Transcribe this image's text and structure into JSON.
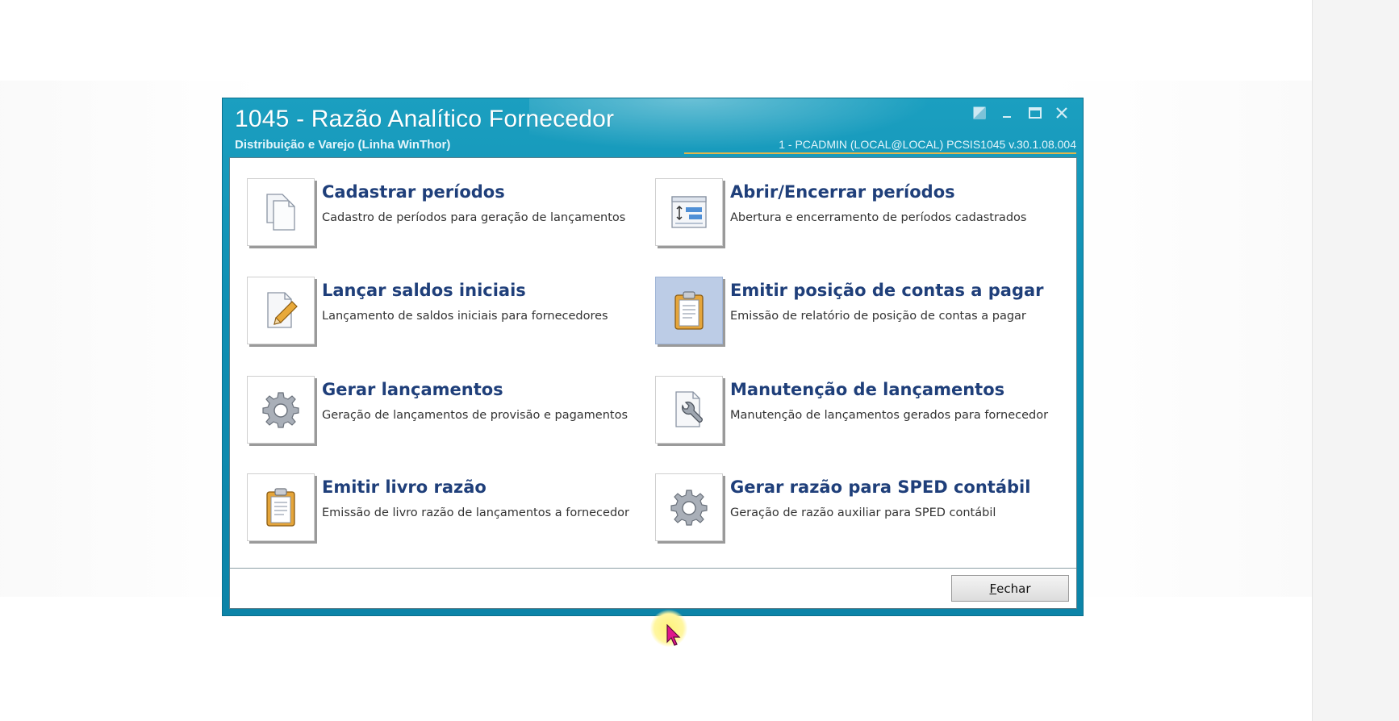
{
  "window": {
    "title": "1045 - Razão Analítico Fornecedor",
    "subtitle": "Distribuição e Varejo (Linha WinThor)",
    "user_info": "1 - PCADMIN (LOCAL@LOCAL)   PCSIS1045  v.30.1.08.004"
  },
  "tiles": [
    {
      "title": "Cadastrar períodos",
      "description": "Cadastro de períodos para geração de lançamentos",
      "icon": "documents-icon"
    },
    {
      "title": "Abrir/Encerrar períodos",
      "description": "Abertura e encerramento de períodos cadastrados",
      "icon": "period-form-icon"
    },
    {
      "title": "Lançar saldos iniciais",
      "description": "Lançamento de saldos iniciais para fornecedores",
      "icon": "edit-document-icon"
    },
    {
      "title": "Emitir posição de contas a pagar",
      "description": "Emissão de relatório de posição de contas a pagar",
      "icon": "clipboard-icon"
    },
    {
      "title": "Gerar lançamentos",
      "description": "Geração de lançamentos de provisão e pagamentos",
      "icon": "gear-icon"
    },
    {
      "title": "Manutenção de lançamentos",
      "description": "Manutenção de lançamentos gerados para fornecedor",
      "icon": "wrench-document-icon"
    },
    {
      "title": "Emitir livro razão",
      "description": "Emissão de livro razão de lançamentos a fornecedor",
      "icon": "clipboard-icon"
    },
    {
      "title": "Gerar razão para SPED contábil",
      "description": "Geração de razão auxiliar para SPED contábil",
      "icon": "gear-icon"
    }
  ],
  "footer": {
    "close_mnemonic": "F",
    "close_rest": "echar"
  },
  "colors": {
    "titlebar": "#0f8fb3",
    "tile_title": "#1f3f7a",
    "active_tile": "#bccce6"
  }
}
